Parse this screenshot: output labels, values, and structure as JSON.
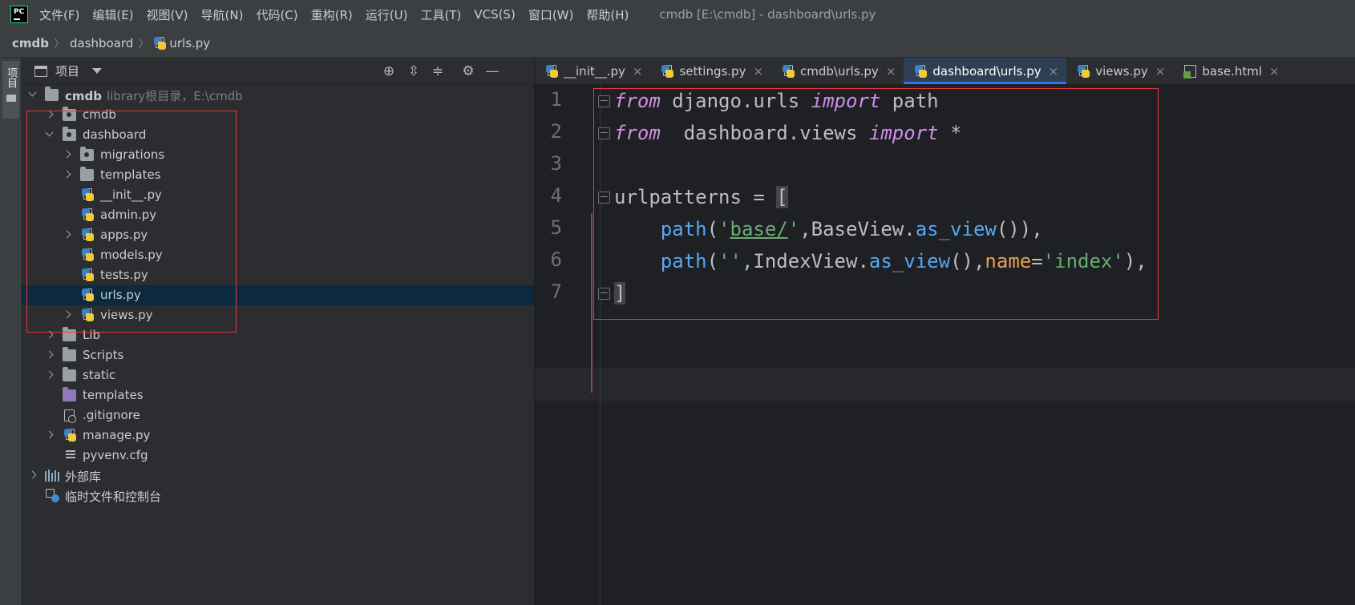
{
  "menubar": {
    "logo_text": "PC",
    "items": [
      "文件(F)",
      "编辑(E)",
      "视图(V)",
      "导航(N)",
      "代码(C)",
      "重构(R)",
      "运行(U)",
      "工具(T)",
      "VCS(S)",
      "窗口(W)",
      "帮助(H)"
    ],
    "window_title": "cmdb [E:\\cmdb] - dashboard\\urls.py"
  },
  "breadcrumb": [
    "cmdb",
    "dashboard",
    "urls.py"
  ],
  "tool_stripe": {
    "project_label": "项目"
  },
  "project_panel": {
    "title": "项目",
    "tools": [
      "locate-icon",
      "expand-all-icon",
      "collapse-all-icon",
      "gear-icon",
      "minimize-icon"
    ],
    "root": {
      "name": "cmdb",
      "meta": "library根目录，E:\\cmdb"
    },
    "items": [
      {
        "name": "cmdb",
        "type": "package"
      },
      {
        "name": "dashboard",
        "type": "package"
      },
      {
        "name": "migrations",
        "type": "package"
      },
      {
        "name": "templates",
        "type": "folder"
      },
      {
        "name": "__init__.py",
        "type": "python"
      },
      {
        "name": "admin.py",
        "type": "python"
      },
      {
        "name": "apps.py",
        "type": "python"
      },
      {
        "name": "models.py",
        "type": "python"
      },
      {
        "name": "tests.py",
        "type": "python"
      },
      {
        "name": "urls.py",
        "type": "python"
      },
      {
        "name": "views.py",
        "type": "python"
      },
      {
        "name": "Lib",
        "type": "folder"
      },
      {
        "name": "Scripts",
        "type": "folder"
      },
      {
        "name": "static",
        "type": "folder"
      },
      {
        "name": "templates",
        "type": "templates-folder"
      },
      {
        "name": ".gitignore",
        "type": "gitignore"
      },
      {
        "name": "manage.py",
        "type": "python"
      },
      {
        "name": "pyvenv.cfg",
        "type": "config"
      },
      {
        "name": "外部库",
        "type": "libraries"
      },
      {
        "name": "临时文件和控制台",
        "type": "scratches"
      }
    ]
  },
  "editor": {
    "tabs": [
      {
        "label": "__init__.py"
      },
      {
        "label": "settings.py"
      },
      {
        "label": "cmdb\\urls.py"
      },
      {
        "label": "dashboard\\urls.py",
        "active": true
      },
      {
        "label": "views.py"
      },
      {
        "label": "base.html"
      }
    ],
    "close_glyph": "×",
    "line_numbers": [
      "1",
      "2",
      "3",
      "4",
      "5",
      "6",
      "7"
    ],
    "code": {
      "l1": {
        "t1": "from",
        "t2": " django.urls ",
        "t3": "import",
        "t4": " path"
      },
      "l2": {
        "t1": "from",
        "t2": "  dashboard.views ",
        "t3": "import",
        "t4": " *"
      },
      "l4": {
        "t1": "urlpatterns = ",
        "t2": "["
      },
      "l5": {
        "t1": "    ",
        "t2": "path",
        "t3": "(",
        "t4": "'",
        "t5": "base/",
        "t6": "'",
        "t7": ",BaseView.",
        "t8": "as_view",
        "t9": "()),"
      },
      "l6": {
        "t1": "    ",
        "t2": "path",
        "t3": "(",
        "t4": "''",
        "t5": ",IndexView.",
        "t6": "as_view",
        "t7": "(),",
        "t8": "name",
        "t9": "=",
        "t10": "'index'",
        "t11": "),"
      },
      "l7": {
        "t1": "]"
      }
    }
  },
  "colors": {
    "keyword": "#cf8ee8",
    "function": "#56a8f5",
    "string": "#6aab73",
    "parameter": "#e6a05a",
    "highlight_box": "#e5393c",
    "selection": "#0d293e",
    "active_tab_underline": "#3574f0"
  }
}
